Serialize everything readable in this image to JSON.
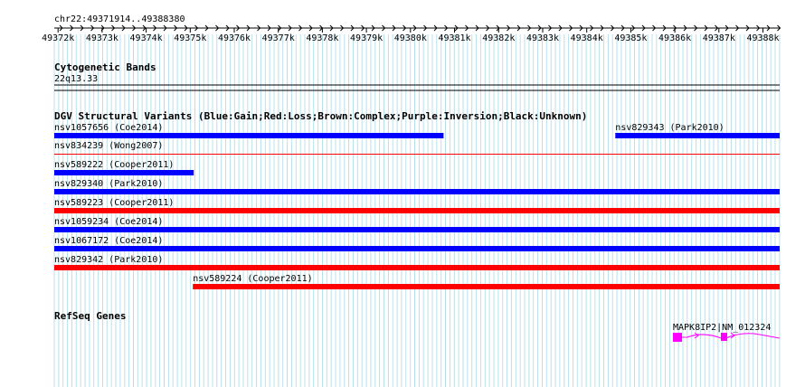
{
  "ruler": {
    "location": "chr22:49371914..49388380",
    "ticks": [
      "49372k",
      "49373k",
      "49374k",
      "49375k",
      "49376k",
      "49377k",
      "49378k",
      "49379k",
      "49380k",
      "49381k",
      "49382k",
      "49383k",
      "49384k",
      "49385k",
      "49386k",
      "49387k",
      "49388k"
    ]
  },
  "cytobands": {
    "title": "Cytogenetic Bands",
    "band": "22q13.33"
  },
  "dgv": {
    "title": "DGV Structural Variants (Blue:Gain;Red:Loss;Brown:Complex;Purple:Inversion;Black:Unknown)",
    "colors": {
      "gain": "#0000ff",
      "loss": "#ff0000"
    },
    "features": [
      {
        "label": "nsv1057656 (Coe2014)",
        "type": "gain",
        "start": 49371914,
        "end": 49380750
      },
      {
        "label": "nsv829343 (Park2010)",
        "type": "gain",
        "start": 49384650,
        "end": 49388380
      },
      {
        "label": "nsv834239 (Wong2007)",
        "type": "loss",
        "start": 49371914,
        "end": 49388380
      },
      {
        "label": "nsv589222 (Cooper2011)",
        "type": "gain",
        "start": 49371914,
        "end": 49375080
      },
      {
        "label": "nsv829340 (Park2010)",
        "type": "gain",
        "start": 49371914,
        "end": 49388380
      },
      {
        "label": "nsv589223 (Cooper2011)",
        "type": "loss",
        "start": 49371914,
        "end": 49388380
      },
      {
        "label": "nsv1059234 (Coe2014)",
        "type": "gain",
        "start": 49371914,
        "end": 49388380
      },
      {
        "label": "nsv1067172 (Coe2014)",
        "type": "gain",
        "start": 49371914,
        "end": 49388380
      },
      {
        "label": "nsv829342 (Park2010)",
        "type": "loss",
        "start": 49371914,
        "end": 49388380
      },
      {
        "label": "nsv589224 (Cooper2011)",
        "type": "loss",
        "start": 49375060,
        "end": 49388380
      }
    ]
  },
  "refseq": {
    "title": "RefSeq Genes",
    "gene_label": "MAPK8IP2|NM_012324",
    "color": "#ff00ff"
  }
}
